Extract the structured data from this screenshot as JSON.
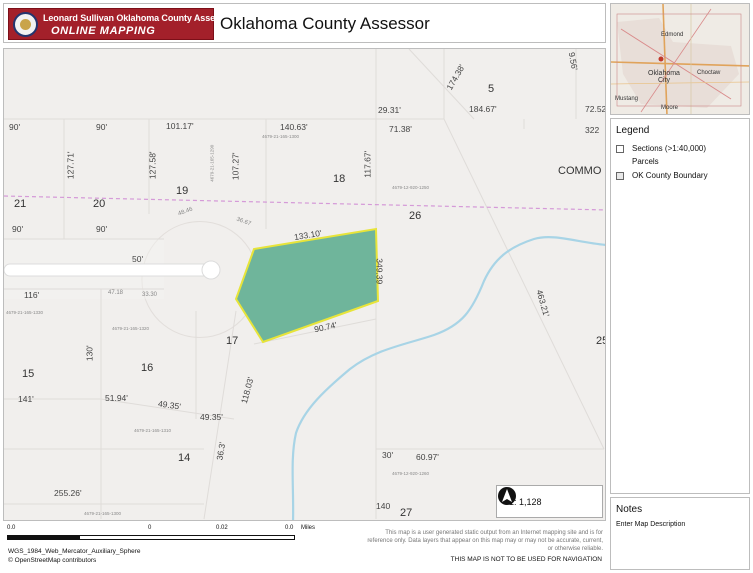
{
  "header": {
    "logo_line1": "Leonard Sullivan Oklahoma County Assessor",
    "logo_line2": "ONLINE MAPPING",
    "title": "Oklahoma County Assessor"
  },
  "overview": {
    "labels": [
      "Edmond",
      "Choctaw",
      "Oklahoma City",
      "Mustang",
      "Moore"
    ]
  },
  "legend": {
    "title": "Legend",
    "items": [
      {
        "label": "Sections (>1:40,000)",
        "swatch": "#ffffff"
      },
      {
        "label": "Parcels",
        "swatch": ""
      },
      {
        "label": "OK County Boundary",
        "swatch": "#e8e8e8"
      }
    ]
  },
  "notes": {
    "title": "Notes",
    "body": "Enter Map Description"
  },
  "map": {
    "colors": {
      "background": "#f1efed",
      "selected_parcel_fill": "#6fb59b",
      "selected_parcel_outline": "#e7e43a",
      "creek": "#a8d4e6",
      "section_line": "#d59ad8"
    },
    "lot_numbers": [
      "5",
      "19",
      "18",
      "21",
      "20",
      "26",
      "17",
      "15",
      "16",
      "14",
      "27",
      "25"
    ],
    "street_labels": [
      "COMMO"
    ],
    "dimensions": [
      "174.38'",
      "9.56'",
      "29.31'",
      "184.67'",
      "72.52",
      "322",
      "90'",
      "90'",
      "101.17'",
      "140.63'",
      "71.38'",
      "127.71'",
      "127.58'",
      "107.27'",
      "117.67'",
      "90'",
      "90'",
      "133.10'",
      "50'",
      "116'",
      "130'",
      "141'",
      "51.94'",
      "49.35'",
      "49.35'",
      "118.03'",
      "36.3'",
      "90.74'",
      "30'",
      "60.97'",
      "255.26'",
      "140",
      "463.21'",
      "349.39",
      "47.18",
      "33.30",
      "48.46",
      "36.67"
    ],
    "parcel_ids": [
      "4679-21-165-1300",
      "4679-21-165-1290",
      "4679-12-920-1250",
      "4679-21-165-1330",
      "4679-21-165-1320",
      "4679-21-165-1310",
      "4679-12-920-1260",
      "4679-21-165-1300"
    ],
    "scale_ratio": "1: 1,128"
  },
  "footer": {
    "scale_ticks": [
      "0.0",
      "0",
      "0.02",
      "0.0",
      "Miles"
    ],
    "crs": "WGS_1984_Web_Mercator_Auxiliary_Sphere",
    "attribution": "© OpenStreetMap contributors",
    "disclaimer": "This map is a user generated static output from an Internet mapping site and is for reference only. Data layers that appear on this map may or may not be accurate, current, or otherwise reliable.",
    "nav_warning": "THIS MAP IS NOT TO BE USED FOR NAVIGATION"
  }
}
